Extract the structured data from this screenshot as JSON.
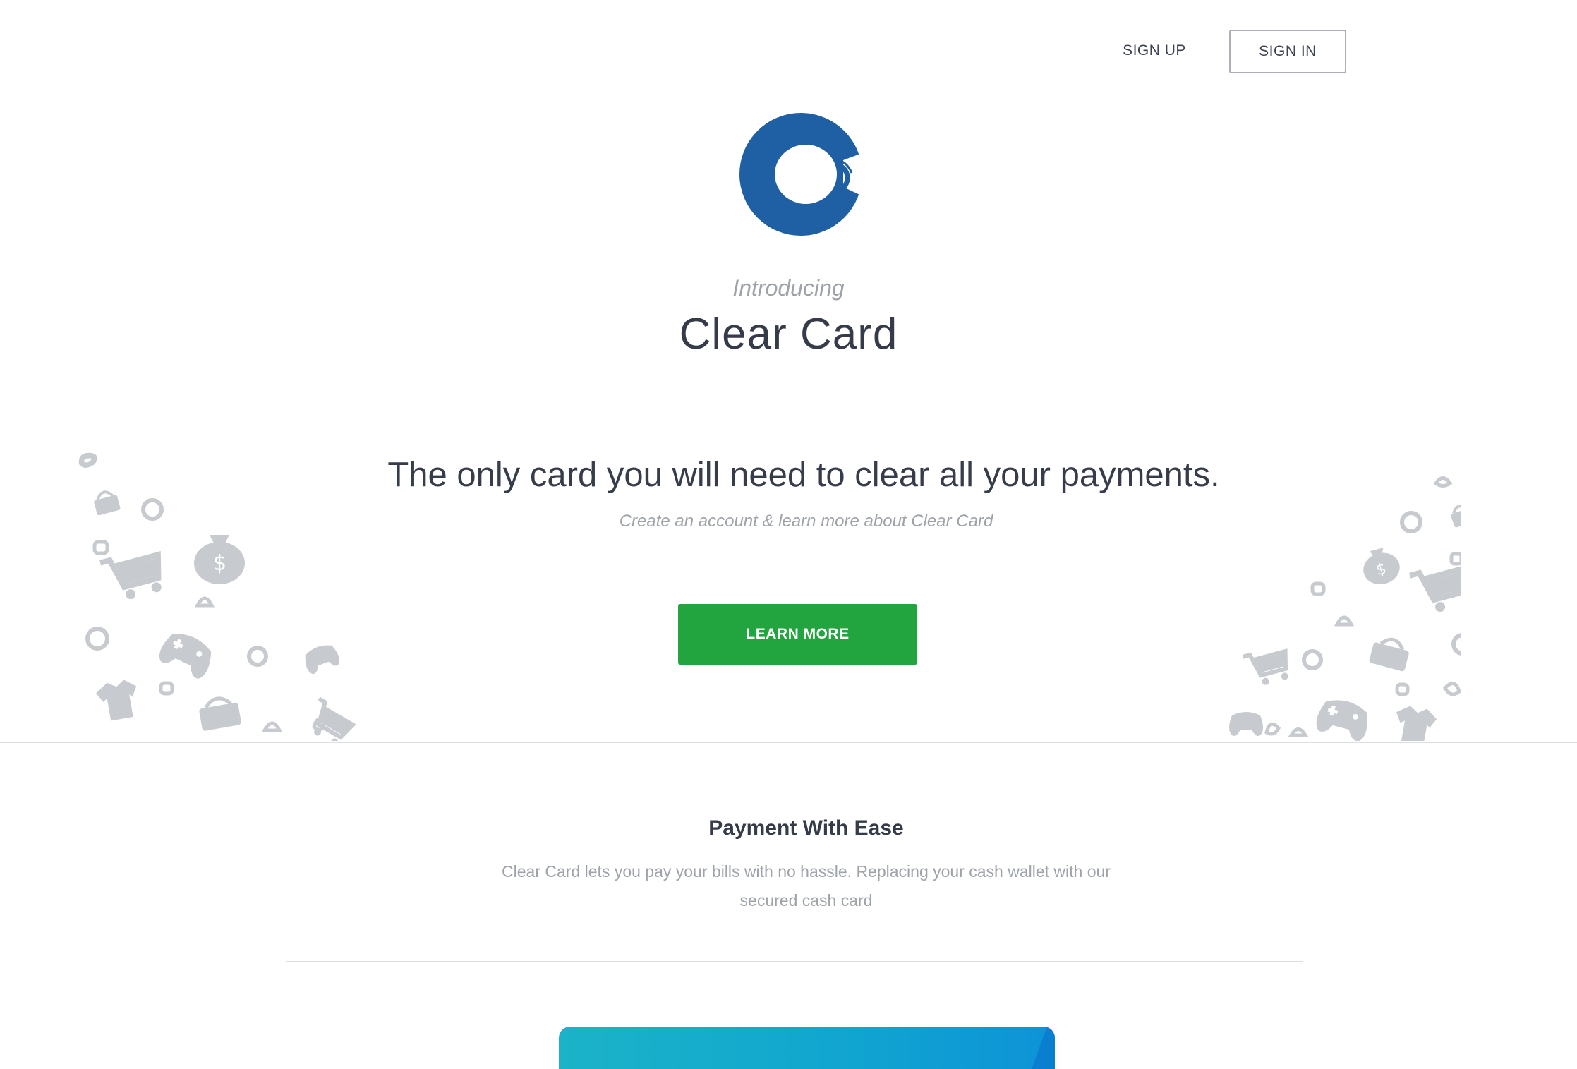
{
  "nav": {
    "signup_label": "SIGN UP",
    "signin_label": "SIGN IN"
  },
  "hero": {
    "intro": "Introducing",
    "brand": "Clear Card",
    "headline": "The only card you will need to clear all your payments.",
    "subline": "Create an account & learn more about Clear Card",
    "cta_label": "LEARN MORE"
  },
  "feature": {
    "title": "Payment With Ease",
    "text": "Clear Card lets you pay your bills with no hassle. Replacing your cash wallet with our secured cash card"
  },
  "colors": {
    "logo": "#1f5fa3",
    "cta": "#22a43f",
    "doodle": "#c7cbcf",
    "card": "#11a6cf"
  },
  "icons": [
    "brush-circle-logo",
    "shopping-cart-icon",
    "money-bag-icon",
    "gamepad-icon",
    "basket-icon",
    "tshirt-icon",
    "circle-icon",
    "pick-icon"
  ]
}
